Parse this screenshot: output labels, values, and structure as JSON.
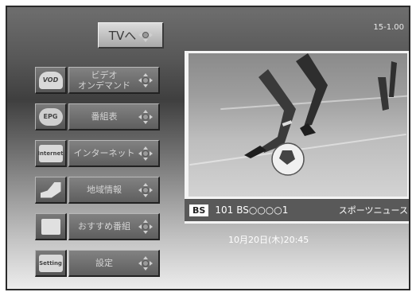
{
  "version": "15-1.00",
  "tv_button": {
    "label": "TVへ"
  },
  "menu": [
    {
      "label": "ビデオ\nオンデマンド",
      "icon": "vod-icon",
      "icon_text": "VOD"
    },
    {
      "label": "番組表",
      "icon": "epg-icon",
      "icon_text": "EPG"
    },
    {
      "label": "インターネット",
      "icon": "internet-icon",
      "icon_text": "Internet"
    },
    {
      "label": "地域情報",
      "icon": "area-map-icon",
      "icon_text": ""
    },
    {
      "label": "おすすめ番組",
      "icon": "tv-recommend-icon",
      "icon_text": ""
    },
    {
      "label": "設定",
      "icon": "setting-icon",
      "icon_text": "Setting"
    }
  ],
  "preview": {
    "badge": "BS",
    "channel_number": "101",
    "channel_name": "BS○○○○1",
    "program": "スポーツニュース"
  },
  "datetime": "10月20日(木)20:45"
}
